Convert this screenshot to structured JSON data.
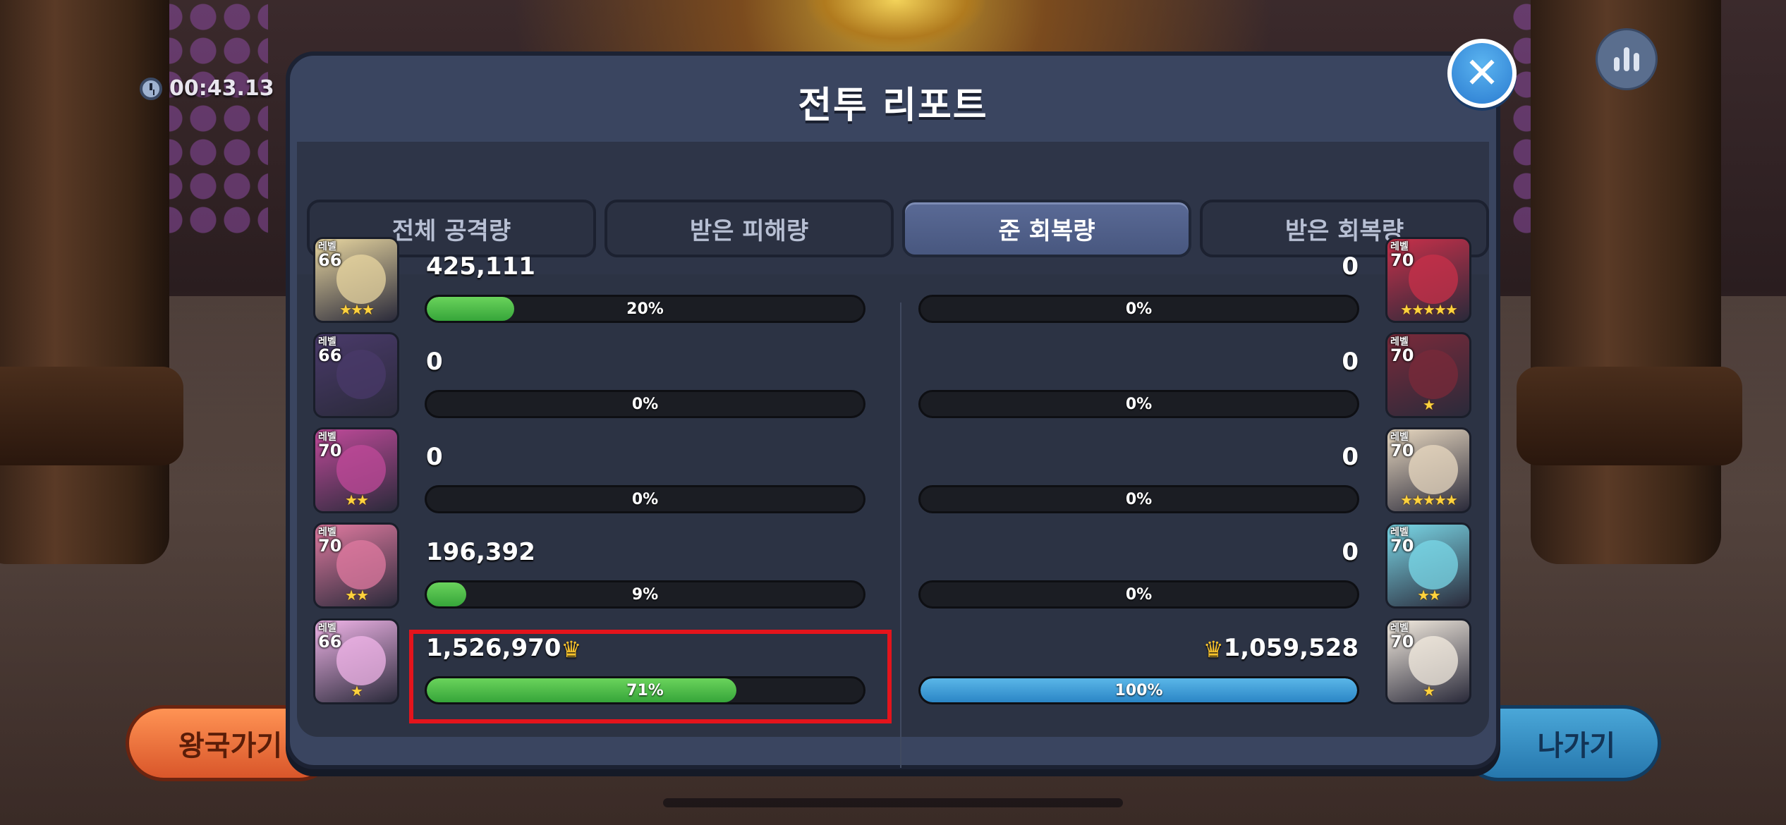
{
  "timer": {
    "value": "00:43.13"
  },
  "modal": {
    "title": "전투 리포트",
    "tabs": [
      {
        "label": "전체 공격량",
        "active": false
      },
      {
        "label": "받은 피해량",
        "active": false
      },
      {
        "label": "준 회복량",
        "active": true
      },
      {
        "label": "받은 회복량",
        "active": false
      }
    ]
  },
  "left_team": [
    {
      "level_label": "레벨",
      "level": "66",
      "stars": "★★★",
      "amount": "425,111",
      "percent_label": "20%",
      "percent": 20,
      "crown": false,
      "color": "#e8d6a0"
    },
    {
      "level_label": "레벨",
      "level": "66",
      "stars": "",
      "amount": "0",
      "percent_label": "0%",
      "percent": 0,
      "crown": false,
      "color": "#4a3a6a"
    },
    {
      "level_label": "레벨",
      "level": "70",
      "stars": "★★",
      "amount": "0",
      "percent_label": "0%",
      "percent": 0,
      "crown": false,
      "color": "#c04a9a"
    },
    {
      "level_label": "레벨",
      "level": "70",
      "stars": "★★",
      "amount": "196,392",
      "percent_label": "9%",
      "percent": 9,
      "crown": false,
      "color": "#e07aa0"
    },
    {
      "level_label": "레벨",
      "level": "66",
      "stars": "★",
      "amount": "1,526,970",
      "percent_label": "71%",
      "percent": 71,
      "crown": true,
      "color": "#f0b4e8"
    }
  ],
  "right_team": [
    {
      "level_label": "레벨",
      "level": "70",
      "stars": "★★★★★",
      "amount": "0",
      "percent_label": "0%",
      "percent": 0,
      "crown": false,
      "color": "#c8304a"
    },
    {
      "level_label": "레벨",
      "level": "70",
      "stars": "★",
      "amount": "0",
      "percent_label": "0%",
      "percent": 0,
      "crown": false,
      "color": "#7a2a3a"
    },
    {
      "level_label": "레벨",
      "level": "70",
      "stars": "★★★★★",
      "amount": "0",
      "percent_label": "0%",
      "percent": 0,
      "crown": false,
      "color": "#e8d8c0"
    },
    {
      "level_label": "레벨",
      "level": "70",
      "stars": "★★",
      "amount": "0",
      "percent_label": "0%",
      "percent": 0,
      "crown": false,
      "color": "#7ad8e8"
    },
    {
      "level_label": "레벨",
      "level": "70",
      "stars": "★",
      "amount": "1,059,528",
      "percent_label": "100%",
      "percent": 100,
      "crown": true,
      "color": "#f4ece0"
    }
  ],
  "buttons": {
    "kingdom": "왕국가기",
    "exit": "나가기"
  },
  "icons": {
    "close": "close-icon",
    "stats": "stats-icon",
    "crown": "crown-icon",
    "clock": "clock-icon"
  },
  "colors": {
    "left_bar": "#3fae3e",
    "right_bar": "#2f8fd0",
    "highlight": "#e4141c"
  }
}
